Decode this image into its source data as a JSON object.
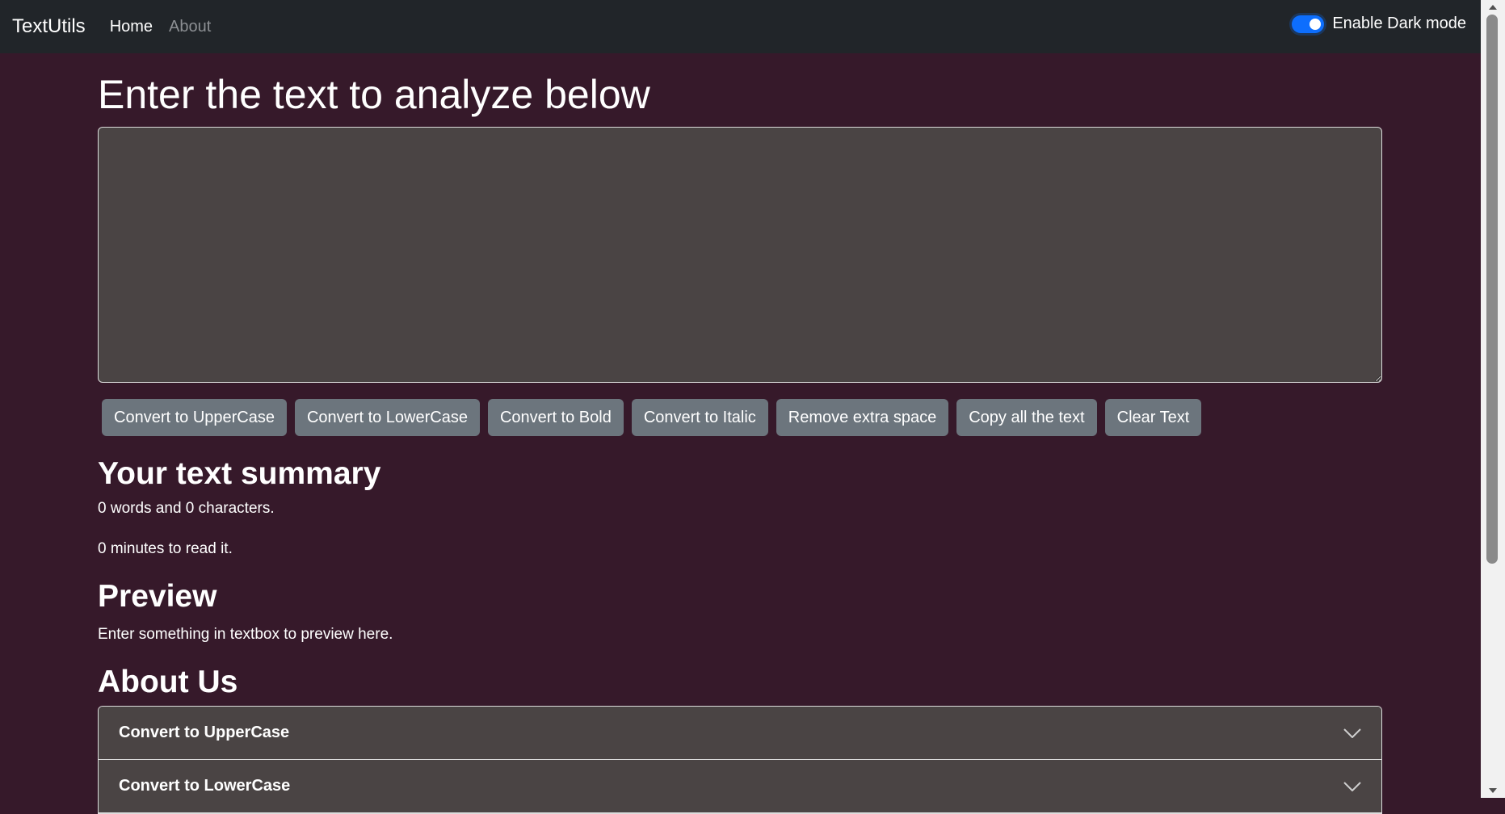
{
  "navbar": {
    "brand": "TextUtils",
    "links": [
      "Home",
      "About"
    ],
    "toggle_label": "Enable Dark mode",
    "toggle_state": "on"
  },
  "main": {
    "heading": "Enter the text to analyze below",
    "textarea_value": "",
    "buttons": [
      "Convert to UpperCase",
      "Convert to LowerCase",
      "Convert to Bold",
      "Convert to Italic",
      "Remove extra space",
      "Copy all the text",
      "Clear Text"
    ]
  },
  "summary": {
    "heading": "Your text summary",
    "words_chars": "0 words and 0 characters.",
    "read_time": "0 minutes to read it."
  },
  "preview": {
    "heading": "Preview",
    "text": "Enter something in textbox to preview here."
  },
  "about": {
    "heading": "About Us",
    "accordion_items": [
      "Convert to UpperCase",
      "Convert to LowerCase"
    ]
  },
  "colors": {
    "page_bg": "#36192a",
    "navbar_bg": "#212529",
    "button_bg": "#6c757d",
    "textarea_bg": "#4a4444",
    "toggle_accent": "#0d6efd"
  }
}
